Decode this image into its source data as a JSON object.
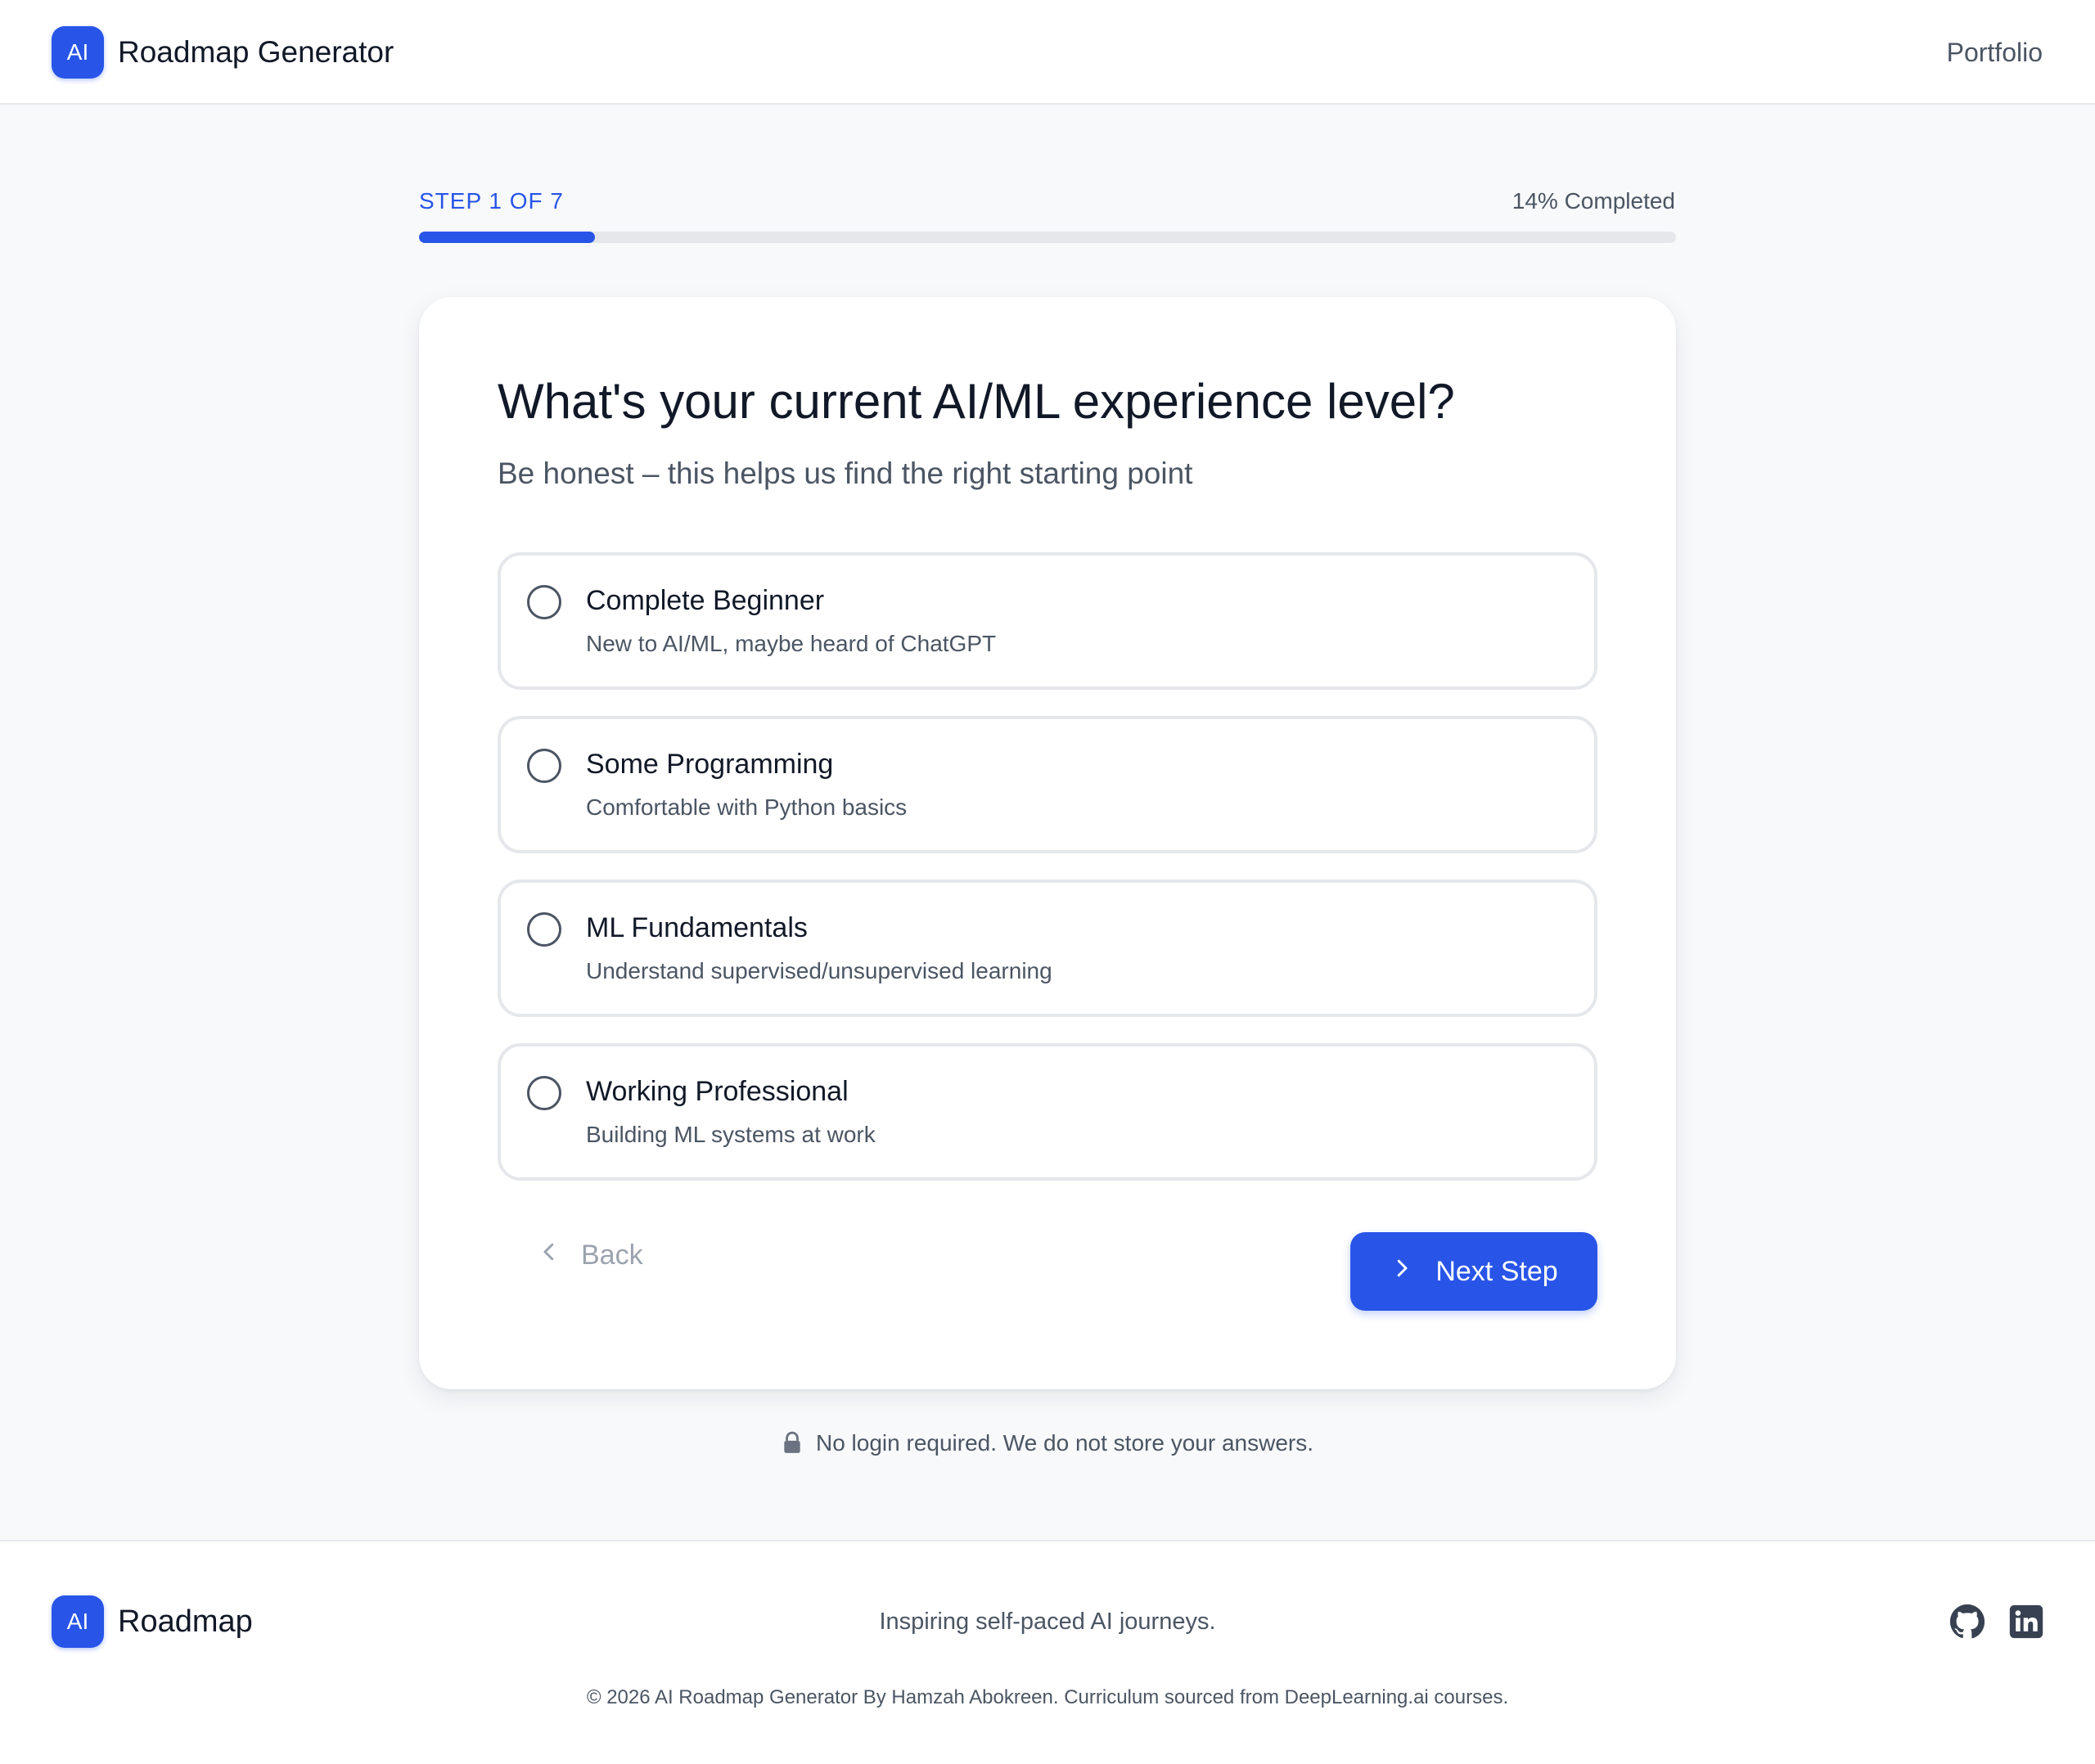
{
  "header": {
    "logo_text": "AI",
    "brand": "Roadmap Generator",
    "nav_link": "Portfolio"
  },
  "progress": {
    "step_label": "STEP 1 OF 7",
    "completed_label": "14% Completed",
    "percent": 14
  },
  "question": {
    "title": "What's your current AI/ML experience level?",
    "subtitle": "Be honest – this helps us find the right starting point",
    "options": [
      {
        "title": "Complete Beginner",
        "description": "New to AI/ML, maybe heard of ChatGPT",
        "selected": false
      },
      {
        "title": "Some Programming",
        "description": "Comfortable with Python basics",
        "selected": false
      },
      {
        "title": "ML Fundamentals",
        "description": "Understand supervised/unsupervised learning",
        "selected": false
      },
      {
        "title": "Working Professional",
        "description": "Building ML systems at work",
        "selected": false
      }
    ]
  },
  "actions": {
    "back_label": "Back",
    "next_label": "Next Step"
  },
  "privacy_note": "No login required. We do not store your answers.",
  "footer": {
    "logo_text": "AI",
    "brand": "Roadmap",
    "tagline": "Inspiring self-paced AI journeys.",
    "copyright": "© 2026 AI Roadmap Generator By Hamzah Abokreen. Curriculum sourced from DeepLearning.ai courses.",
    "social_icons": [
      "github-icon",
      "linkedin-icon"
    ]
  },
  "colors": {
    "accent": "#2855e8",
    "text_primary": "#111827",
    "text_secondary": "#4b5563",
    "border": "#e5e7eb",
    "background": "#f8f9fb"
  }
}
